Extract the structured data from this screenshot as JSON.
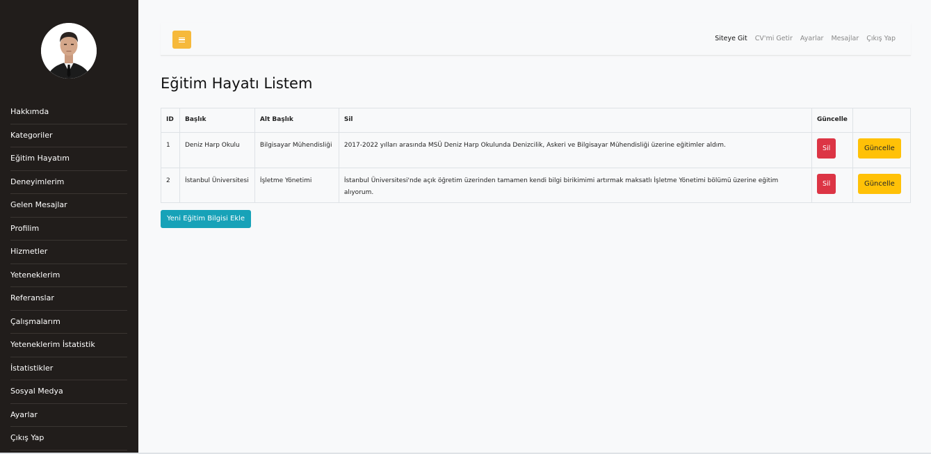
{
  "sidebar": {
    "items": [
      {
        "label": "Hakkımda"
      },
      {
        "label": "Kategoriler"
      },
      {
        "label": "Eğitim Hayatım"
      },
      {
        "label": "Deneyimlerim"
      },
      {
        "label": "Gelen Mesajlar"
      },
      {
        "label": "Profilim"
      },
      {
        "label": "Hizmetler"
      },
      {
        "label": "Yeteneklerim"
      },
      {
        "label": "Referanslar"
      },
      {
        "label": "Çalışmalarım"
      },
      {
        "label": "Yeteneklerim İstatistik"
      },
      {
        "label": "İstatistikler"
      },
      {
        "label": "Sosyal Medya"
      },
      {
        "label": "Ayarlar"
      },
      {
        "label": "Çıkış Yap"
      }
    ]
  },
  "topbar": {
    "menu_icon": "hamburger-icon",
    "links": [
      "Siteye Git",
      "CV'mi Getir",
      "Ayarlar",
      "Mesajlar",
      "Çıkış Yap"
    ]
  },
  "page": {
    "title": "Eğitim Hayatı Listem"
  },
  "table": {
    "headers": [
      "ID",
      "Başlık",
      "Alt Başlık",
      "Sil",
      "Güncelle",
      ""
    ],
    "rows": [
      {
        "id": "1",
        "title": "Deniz Harp Okulu",
        "subtitle": "Bilgisayar Mühendisliği",
        "description": "2017-2022 yılları arasında MSÜ Deniz Harp Okulunda Denizcilik, Askeri ve Bilgisayar Mühendisliği üzerine eğitimler aldım.",
        "delete_label": "Sil",
        "update_label": "Güncelle"
      },
      {
        "id": "2",
        "title": "İstanbul Üniversitesi",
        "subtitle": "İşletme Yönetimi",
        "description": "İstanbul Üniversitesi'nde açık öğretim üzerinden tamamen kendi bilgi birikimimi artırmak maksatlı İşletme Yönetimi bölümü üzerine eğitim alıyorum.",
        "delete_label": "Sil",
        "update_label": "Güncelle"
      }
    ]
  },
  "actions": {
    "add_label": "Yeni Eğitim Bilgisi Ekle"
  },
  "colors": {
    "sidebar_bg": "#211d1b",
    "menu_btn": "#f6b93b",
    "delete": "#dc3545",
    "update": "#ffc107",
    "add": "#17a2b8"
  }
}
